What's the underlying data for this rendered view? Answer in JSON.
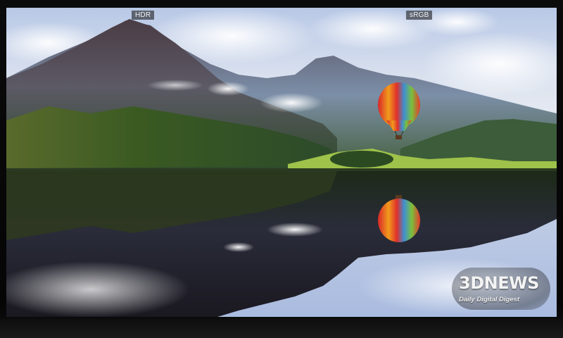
{
  "labels": {
    "left": "HDR",
    "right": "sRGB"
  },
  "watermark": {
    "brand": "3DNEWS",
    "tagline": "Daily Digital Digest"
  },
  "scene": {
    "subject": "mountain-lake-reflection-with-hot-air-balloon",
    "balloon_colors": [
      "#e0302a",
      "#f2a21c",
      "#3a8fd1",
      "#6bbf3a"
    ]
  }
}
